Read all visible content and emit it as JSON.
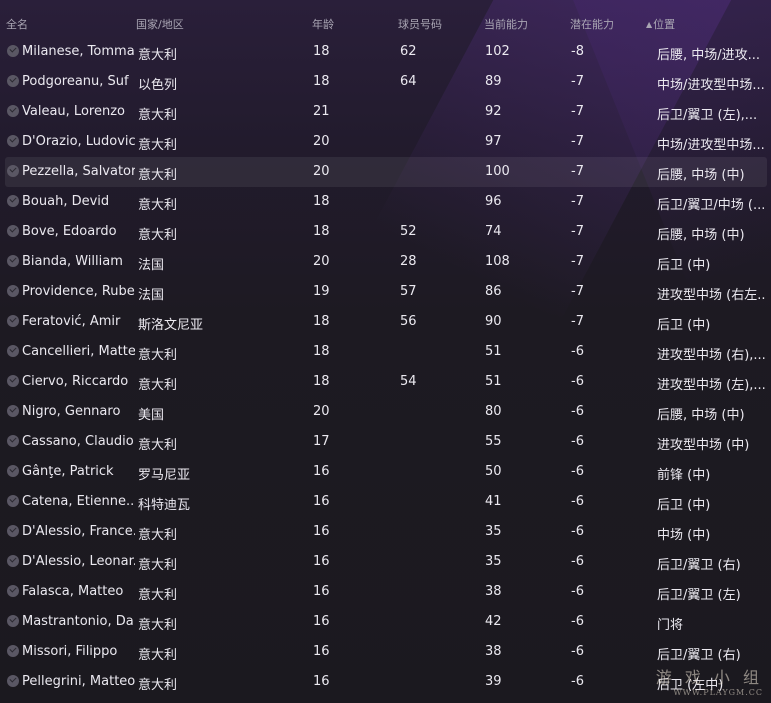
{
  "columns": {
    "name": "全名",
    "nationality": "国家/地区",
    "age": "年龄",
    "squad_number": "球员号码",
    "current_ability": "当前能力",
    "potential_ability": "潜在能力",
    "position": "位置",
    "sort_icon": "▲"
  },
  "rows": [
    {
      "name": "Milanese, Tomma...",
      "nationality": "意大利",
      "age": "18",
      "number": "62",
      "ca": "102",
      "pa": "-8",
      "position": "后腰, 中场/进攻..."
    },
    {
      "name": "Podgoreanu, Suf",
      "nationality": "以色列",
      "age": "18",
      "number": "64",
      "ca": "89",
      "pa": "-7",
      "position": "中场/进攻型中场..."
    },
    {
      "name": "Valeau, Lorenzo",
      "nationality": "意大利",
      "age": "21",
      "number": "",
      "ca": "92",
      "pa": "-7",
      "position": "后卫/翼卫 (左),..."
    },
    {
      "name": "D'Orazio, Ludovico",
      "nationality": "意大利",
      "age": "20",
      "number": "",
      "ca": "97",
      "pa": "-7",
      "position": "中场/进攻型中场..."
    },
    {
      "name": "Pezzella, Salvatore",
      "nationality": "意大利",
      "age": "20",
      "number": "",
      "ca": "100",
      "pa": "-7",
      "position": "后腰, 中场 (中)"
    },
    {
      "name": "Bouah, Devid",
      "nationality": "意大利",
      "age": "18",
      "number": "",
      "ca": "96",
      "pa": "-7",
      "position": "后卫/翼卫/中场 (..."
    },
    {
      "name": "Bove, Edoardo",
      "nationality": "意大利",
      "age": "18",
      "number": "52",
      "ca": "74",
      "pa": "-7",
      "position": "后腰, 中场 (中)"
    },
    {
      "name": "Bianda, William",
      "nationality": "法国",
      "age": "20",
      "number": "28",
      "ca": "108",
      "pa": "-7",
      "position": "后卫 (中)"
    },
    {
      "name": "Providence, Ruben",
      "nationality": "法国",
      "age": "19",
      "number": "57",
      "ca": "86",
      "pa": "-7",
      "position": "进攻型中场 (右左..."
    },
    {
      "name": "Feratović, Amir",
      "nationality": "斯洛文尼亚",
      "age": "18",
      "number": "56",
      "ca": "90",
      "pa": "-7",
      "position": "后卫 (中)"
    },
    {
      "name": "Cancellieri, Matteo",
      "nationality": "意大利",
      "age": "18",
      "number": "",
      "ca": "51",
      "pa": "-6",
      "position": "进攻型中场 (右),..."
    },
    {
      "name": "Ciervo, Riccardo",
      "nationality": "意大利",
      "age": "18",
      "number": "54",
      "ca": "51",
      "pa": "-6",
      "position": "进攻型中场 (左),..."
    },
    {
      "name": "Nigro, Gennaro",
      "nationality": "美国",
      "age": "20",
      "number": "",
      "ca": "80",
      "pa": "-6",
      "position": "后腰, 中场 (中)"
    },
    {
      "name": "Cassano, Claudio",
      "nationality": "意大利",
      "age": "17",
      "number": "",
      "ca": "55",
      "pa": "-6",
      "position": "进攻型中场 (中)"
    },
    {
      "name": "Gânţe, Patrick",
      "nationality": "罗马尼亚",
      "age": "16",
      "number": "",
      "ca": "50",
      "pa": "-6",
      "position": "前锋 (中)"
    },
    {
      "name": "Catena, Etienne...",
      "nationality": "科特迪瓦",
      "age": "16",
      "number": "",
      "ca": "41",
      "pa": "-6",
      "position": "后卫 (中)"
    },
    {
      "name": "D'Alessio, France...",
      "nationality": "意大利",
      "age": "16",
      "number": "",
      "ca": "35",
      "pa": "-6",
      "position": "中场 (中)"
    },
    {
      "name": "D'Alessio, Leonar...",
      "nationality": "意大利",
      "age": "16",
      "number": "",
      "ca": "35",
      "pa": "-6",
      "position": "后卫/翼卫 (右)"
    },
    {
      "name": "Falasca, Matteo",
      "nationality": "意大利",
      "age": "16",
      "number": "",
      "ca": "38",
      "pa": "-6",
      "position": "后卫/翼卫 (左)"
    },
    {
      "name": "Mastrantonio, Da...",
      "nationality": "意大利",
      "age": "16",
      "number": "",
      "ca": "42",
      "pa": "-6",
      "position": "门将"
    },
    {
      "name": "Missori, Filippo",
      "nationality": "意大利",
      "age": "16",
      "number": "",
      "ca": "38",
      "pa": "-6",
      "position": "后卫/翼卫 (右)"
    },
    {
      "name": "Pellegrini, Matteo",
      "nationality": "意大利",
      "age": "16",
      "number": "",
      "ca": "39",
      "pa": "-6",
      "position": "后卫 (左中)"
    }
  ],
  "selected_row": 4,
  "watermark": {
    "title": "游 戏 小 组",
    "url": "WWW.PLAYGM.CC"
  },
  "colors": {
    "background": "#1c1922",
    "row_selected": "rgba(255,255,255,0.07)",
    "header_text": "#a9a5b3",
    "row_text": "#ebe9f0"
  }
}
